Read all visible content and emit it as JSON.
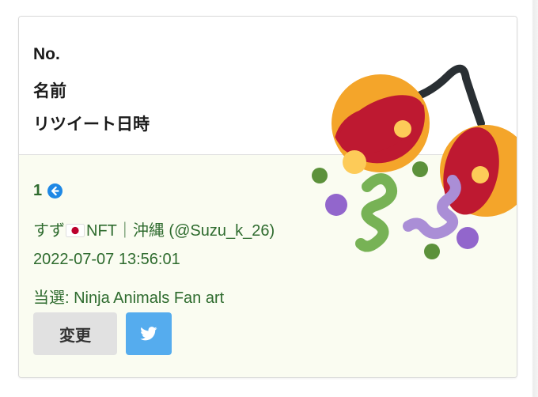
{
  "header": {
    "no_label": "No.",
    "name_label": "名前",
    "retweet_label": "リツイート日時"
  },
  "entry": {
    "number": "1",
    "user_name_prefix": "すず",
    "user_name_suffix": "NFT｜沖縄 (@Suzu_k_26)",
    "retweet_datetime": "2022-07-07 13:56:01",
    "winning_text": "当選: Ninja Animals Fan art"
  },
  "buttons": {
    "change_label": "変更"
  },
  "icons": {
    "back": "arrow-circle-left-icon",
    "flag": "japan-flag-icon",
    "twitter": "twitter-bird-icon",
    "decoration": "confetti-ball-emoji"
  },
  "colors": {
    "body_text_green": "#2e6b2e",
    "body_background": "#fafcf1",
    "twitter_blue": "#55acee",
    "button_grey": "#e1e1e1"
  }
}
